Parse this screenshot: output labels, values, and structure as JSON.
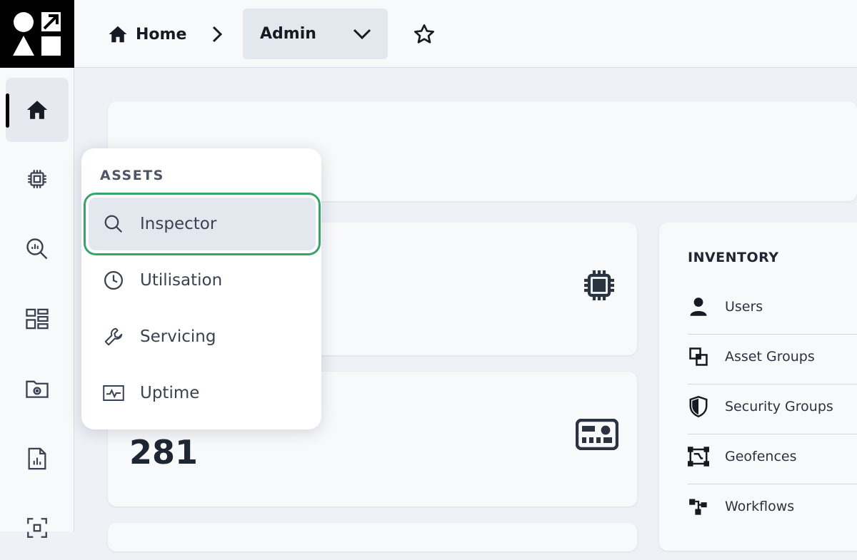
{
  "breadcrumb": {
    "home_label": "Home",
    "admin_label": "Admin"
  },
  "menu": {
    "section_title": "ASSETS",
    "items": [
      {
        "label": "Inspector",
        "icon": "search-icon",
        "selected": true
      },
      {
        "label": "Utilisation",
        "icon": "clock-icon"
      },
      {
        "label": "Servicing",
        "icon": "wrench-icon"
      },
      {
        "label": "Uptime",
        "icon": "pulse-icon"
      }
    ]
  },
  "cards": {
    "second_value": "281"
  },
  "inventory": {
    "title": "INVENTORY",
    "items": [
      {
        "label": "Users",
        "icon": "user-icon"
      },
      {
        "label": "Asset Groups",
        "icon": "asset-groups-icon"
      },
      {
        "label": "Security Groups",
        "icon": "shield-icon"
      },
      {
        "label": "Geofences",
        "icon": "geofence-icon"
      },
      {
        "label": "Workflows",
        "icon": "workflow-icon"
      }
    ]
  },
  "sidebar": {
    "items": [
      {
        "icon": "home-icon",
        "active": true
      },
      {
        "icon": "chip-icon"
      },
      {
        "icon": "analytics-search-icon"
      },
      {
        "icon": "dashboard-icon"
      },
      {
        "icon": "folder-settings-icon"
      },
      {
        "icon": "report-icon"
      },
      {
        "icon": "scan-icon"
      }
    ]
  },
  "colors": {
    "accent_selected_outline": "#3aa36a",
    "logo_background": "#000000",
    "page_background": "#eef1f6"
  }
}
